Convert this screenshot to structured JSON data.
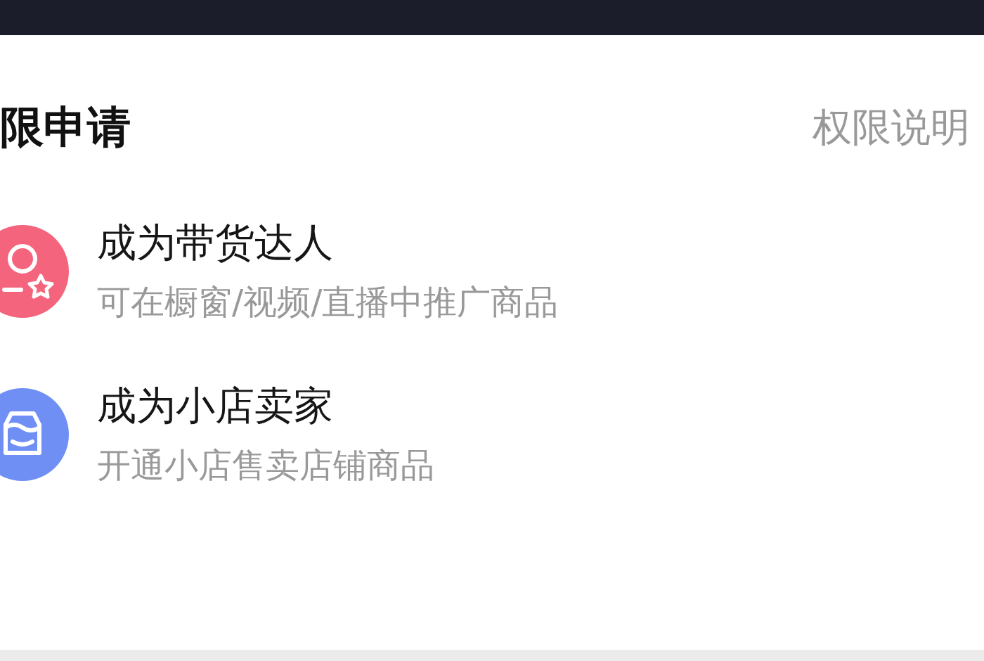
{
  "header": {
    "title": "限申请",
    "link": "权限说明"
  },
  "items": [
    {
      "kind": "creator",
      "color": "#f5647d",
      "title": "成为带货达人",
      "subtitle": "可在橱窗/视频/直播中推广商品"
    },
    {
      "kind": "shop",
      "color": "#6f8ff5",
      "title": "成为小店卖家",
      "subtitle": "开通小店售卖店铺商品"
    }
  ]
}
